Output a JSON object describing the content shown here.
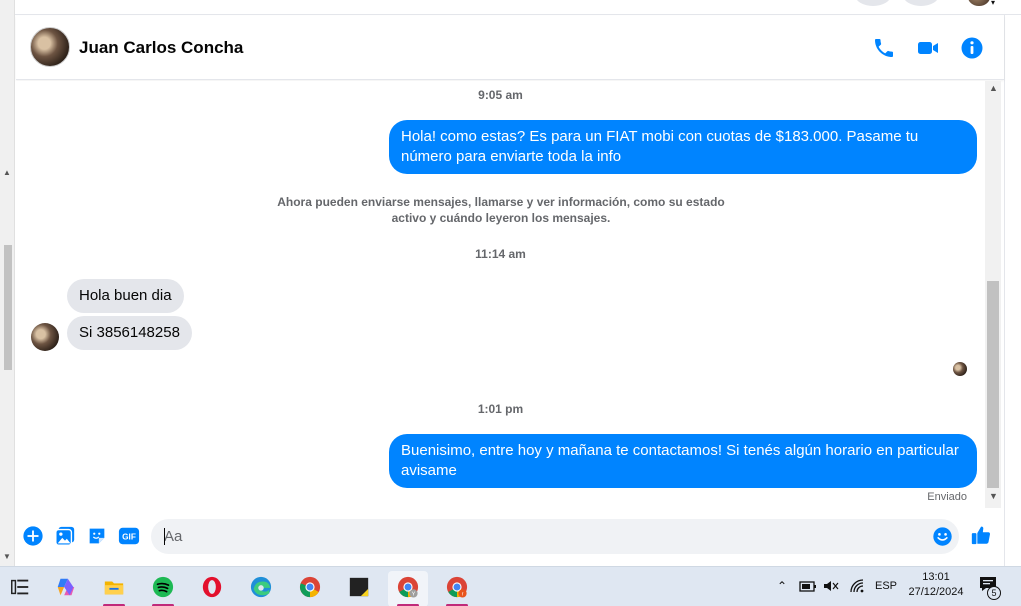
{
  "colors": {
    "accent": "#0084ff",
    "incoming_bubble": "#e4e6eb",
    "taskbar": "#dfe7f2"
  },
  "header": {
    "contact_name": "Juan Carlos Concha",
    "icons": [
      "phone-icon",
      "video-camera-icon",
      "info-icon"
    ]
  },
  "messages": {
    "timestamp_1": "9:05 am",
    "outgoing_1": "Hola! como estas? Es para un FIAT mobi con cuotas de $183.000. Pasame tu número para enviarte toda la info",
    "notice": "Ahora pueden enviarse mensajes, llamarse y ver información, como su estado activo y cuándo leyeron los mensajes.",
    "timestamp_2": "11:14 am",
    "incoming_1": "Hola buen dia",
    "incoming_2": "Si 3856148258",
    "timestamp_3": "1:01 pm",
    "outgoing_2": "Buenisimo, entre hoy y mañana te contactamos! Si tenés algún horario en particular avisame",
    "status": "Enviado"
  },
  "composer": {
    "placeholder": "Aa",
    "icons": [
      "plus-icon",
      "image-icon",
      "sticker-icon",
      "gif-icon",
      "emoji-icon",
      "thumbs-up-icon"
    ],
    "gif_label": "GIF"
  },
  "taskbar": {
    "apps": [
      "task-view",
      "copilot",
      "file-explorer",
      "spotify",
      "opera",
      "edge",
      "chrome",
      "sticky-notes",
      "chrome-profile-y",
      "chrome-profile-r"
    ],
    "language": "ESP",
    "time": "13:01",
    "date": "27/12/2024",
    "notification_count": "5"
  }
}
